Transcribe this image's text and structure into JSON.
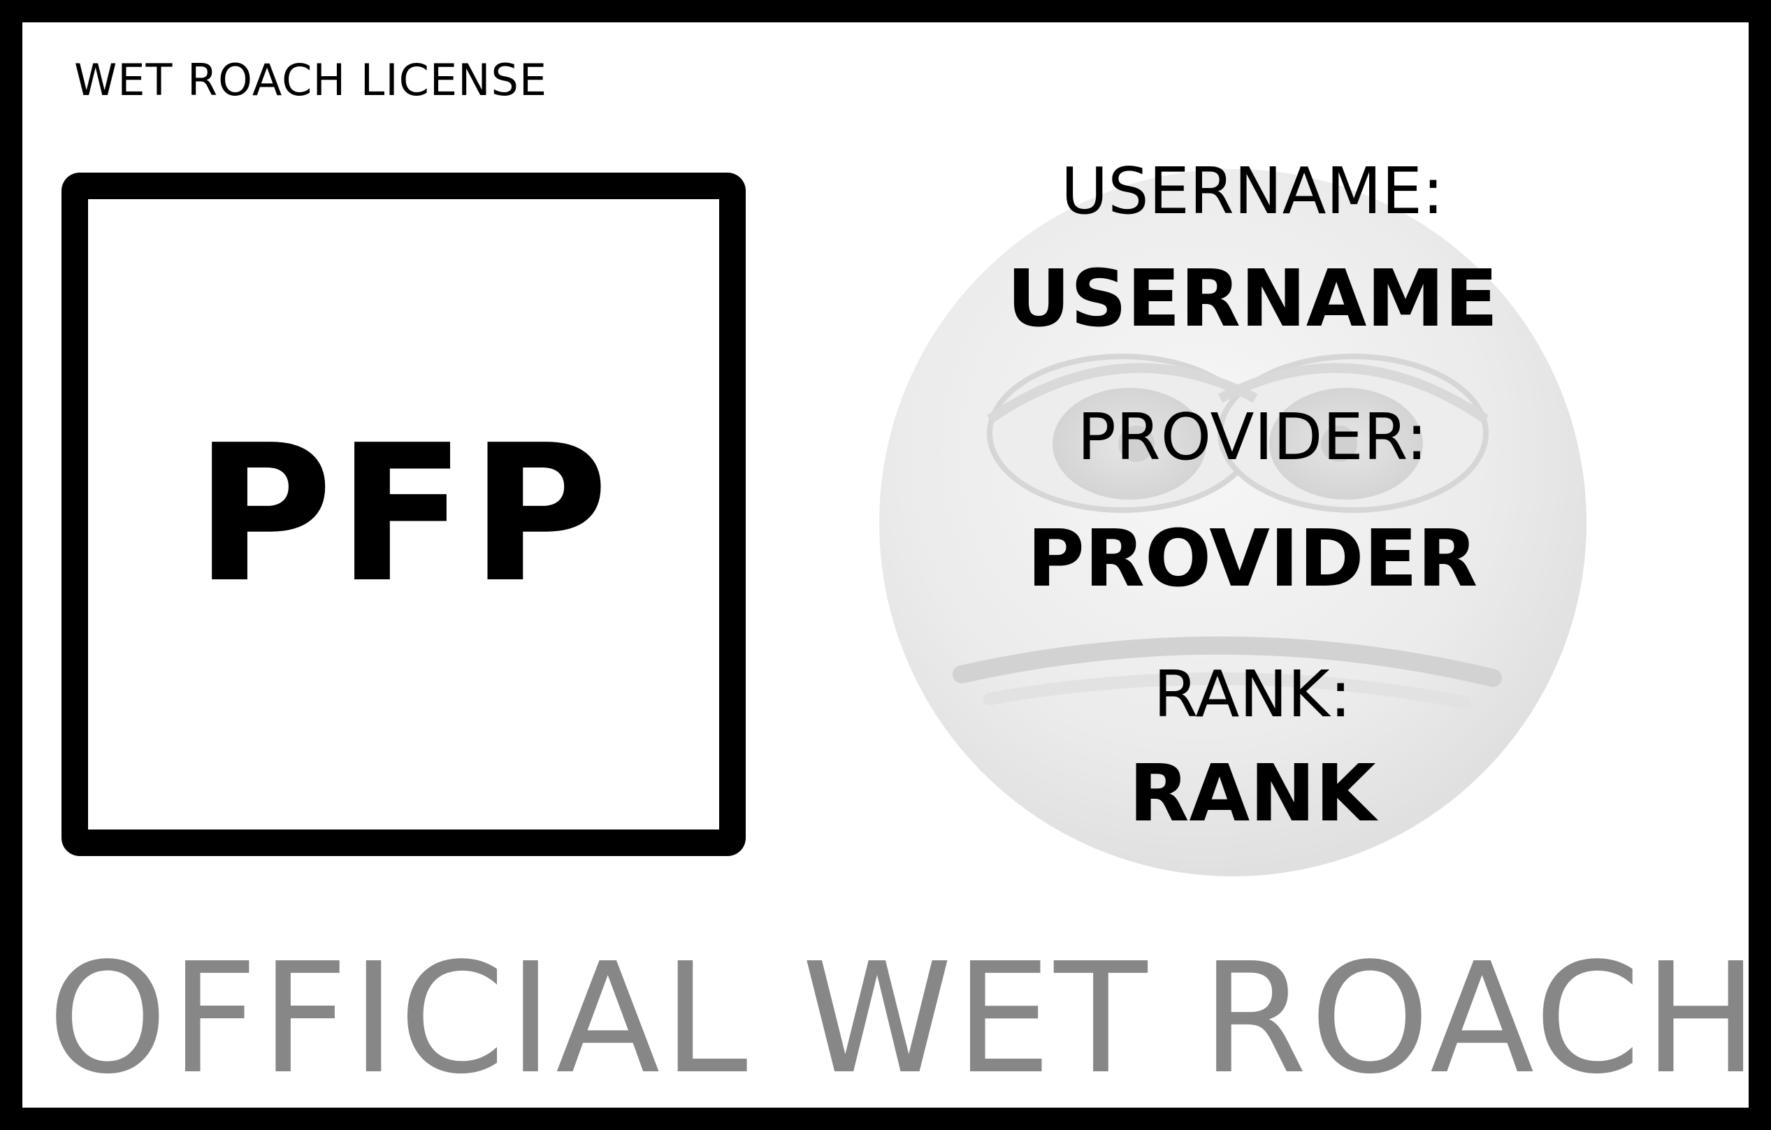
{
  "header": {
    "title": "WET ROACH LICENSE"
  },
  "photo_slot": {
    "label": "PFP"
  },
  "fields": {
    "username_label": "USERNAME:",
    "username_value": "USERNAME",
    "provider_label": "PROVIDER:",
    "provider_value": "PROVIDER",
    "rank_label": "RANK:",
    "rank_value": "RANK"
  },
  "footer": {
    "text": "OFFICIAL WET ROACH"
  },
  "colors": {
    "border": "#000000",
    "text": "#000000",
    "footer_text": "#878787",
    "emblem": "#e6e6e6"
  },
  "emblem": {
    "icon": "sad-face-icon"
  }
}
